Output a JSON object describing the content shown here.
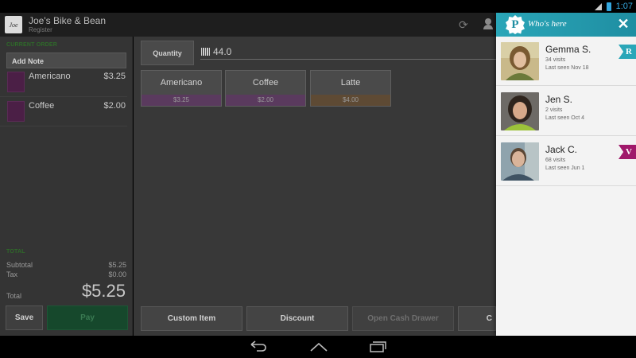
{
  "status_bar": {
    "time": "1:07"
  },
  "app": {
    "title": "Joe's Bike & Bean",
    "subtitle": "Register",
    "logo_text": "Joe"
  },
  "order": {
    "heading": "CURRENT ORDER",
    "add_note_label": "Add Note",
    "items": [
      {
        "name": "Americano",
        "price": "$3.25"
      },
      {
        "name": "Coffee",
        "price": "$2.00"
      }
    ],
    "total_heading": "TOTAL",
    "subtotal_label": "Subtotal",
    "subtotal": "$5.25",
    "tax_label": "Tax",
    "tax": "$0.00",
    "total_label": "Total",
    "total": "$5.25",
    "save_label": "Save",
    "pay_label": "Pay"
  },
  "register": {
    "quantity_label": "Quantity",
    "quantity_value": "44.0",
    "products": [
      {
        "name": "Americano",
        "price": "$3.25",
        "color": "#5a3a5e"
      },
      {
        "name": "Coffee",
        "price": "$2.00",
        "color": "#5a3a5e"
      },
      {
        "name": "Latte",
        "price": "$4.00",
        "color": "#5e4a34"
      }
    ],
    "buttons": [
      {
        "label": "Custom Item",
        "enabled": true
      },
      {
        "label": "Discount",
        "enabled": true
      },
      {
        "label": "Open Cash Drawer",
        "enabled": false
      },
      {
        "label": "C",
        "enabled": true
      }
    ]
  },
  "drawer": {
    "badge_letter": "P",
    "title": "Who's here",
    "customers": [
      {
        "name": "Gemma S.",
        "visits": "34 visits",
        "last_seen": "Last seen Nov 18",
        "tier": "R",
        "tier_color": "#2aa6b8"
      },
      {
        "name": "Jen S.",
        "visits": "2 visits",
        "last_seen": "Last seen Oct 4",
        "tier": "",
        "tier_color": ""
      },
      {
        "name": "Jack C.",
        "visits": "68 visits",
        "last_seen": "Last seen Jun 1",
        "tier": "V",
        "tier_color": "#a0186a"
      }
    ]
  },
  "colors": {
    "accent_teal": "#2aa6b8",
    "pay_green": "#16482c",
    "heading_green": "#2f6a2a"
  }
}
